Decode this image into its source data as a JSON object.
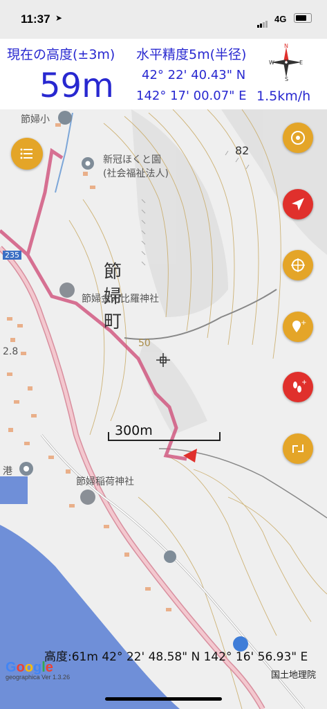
{
  "status_bar": {
    "time": "11:37",
    "location_arrow": "➤",
    "network": "4G"
  },
  "header": {
    "altitude_label": "現在の高度(±3m)",
    "accuracy_label": "水平精度5m(半径)",
    "altitude_value": "59m",
    "latitude": "42° 22' 40.43\" N",
    "longitude": "142° 17' 00.07\" E",
    "speed": "1.5km/h"
  },
  "compass": {
    "north": "N",
    "west": "W",
    "east": "E",
    "south": "S"
  },
  "map_labels": {
    "school": "節婦小",
    "facility_line1": "新冠ほくと園",
    "facility_line2": "(社会福祉法人)",
    "town_1": "節",
    "town_2": "婦",
    "town_3": "町",
    "shrine_1": "節婦金刀比羅神社",
    "shrine_2": "節婦稲荷神社",
    "route": "235",
    "elevation_82": "82",
    "contour_50": "50",
    "port": "港",
    "spot_height": "2.8",
    "scale": "300m"
  },
  "footer": {
    "coords": "高度:61m  42° 22' 48.58\" N  142° 16' 56.93\" E",
    "google": "Google",
    "version": "geographica Ver 1.3.26",
    "gsi": "国土地理院"
  },
  "colors": {
    "accent_blue": "#2828d0",
    "gold": "#e4a528",
    "red": "#e0302c",
    "track": "#d0507a",
    "sea": "#6f8fd8"
  }
}
